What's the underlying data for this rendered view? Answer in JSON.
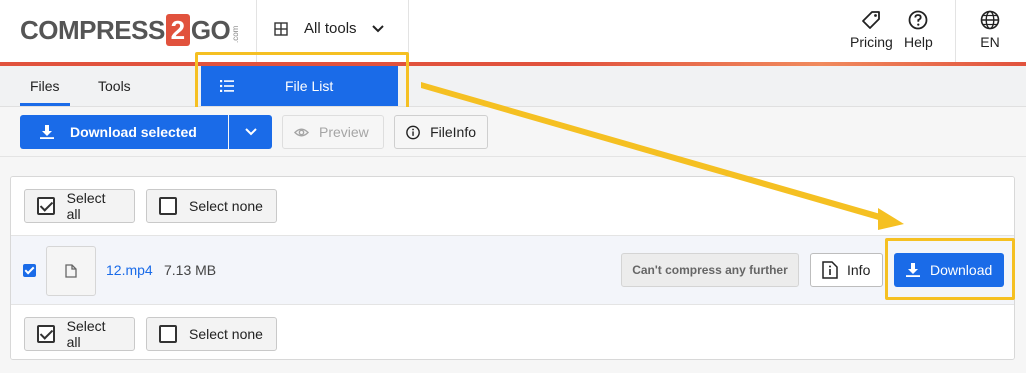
{
  "header": {
    "logo": {
      "part1": "COMPRESS",
      "num": "2",
      "part2": "GO",
      "sub": ".com"
    },
    "all_tools_label": "All tools",
    "pricing_label": "Pricing",
    "help_label": "Help",
    "lang_label": "EN"
  },
  "tabs": {
    "files_label": "Files",
    "tools_label": "Tools",
    "file_list_label": "File List"
  },
  "toolbar": {
    "download_selected_label": "Download selected",
    "preview_label": "Preview",
    "fileinfo_label": "FileInfo"
  },
  "file_panel": {
    "select_all_label": "Select all",
    "select_none_label": "Select none",
    "file": {
      "name": "12.mp4",
      "size": "7.13 MB",
      "status": "Can't compress any further",
      "info_label": "Info",
      "download_label": "Download"
    }
  },
  "colors": {
    "accent": "#1a6be8",
    "brand_red": "#e1523d",
    "highlight": "#f5c022"
  },
  "icons": [
    "grid-icon",
    "chevron-down-icon",
    "tag-icon",
    "help-icon",
    "globe-icon",
    "list-icon",
    "download-icon",
    "eye-icon",
    "info-circle-icon",
    "file-icon",
    "info-doc-icon",
    "checkbox-icon"
  ]
}
